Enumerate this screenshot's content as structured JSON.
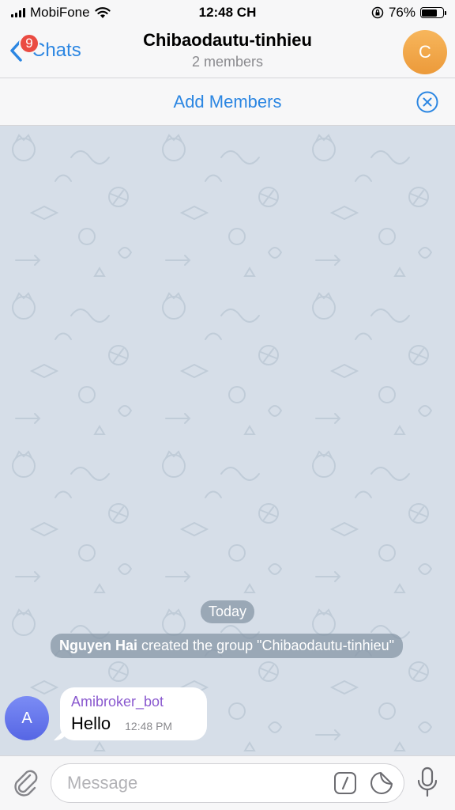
{
  "status_bar": {
    "carrier": "MobiFone",
    "time": "12:48 CH",
    "battery_percent": "76%",
    "battery_level": 0.76
  },
  "nav": {
    "back_label": "Chats",
    "badge_count": "9",
    "title": "Chibaodautu-tinhieu",
    "subtitle": "2 members",
    "avatar_letter": "C"
  },
  "banner": {
    "add_members_label": "Add Members"
  },
  "chat": {
    "date_label": "Today",
    "service_actor": "Nguyen Hai",
    "service_text": "created the group \"Chibaodautu-tinhieu\"",
    "messages": [
      {
        "avatar_letter": "A",
        "sender": "Amibroker_bot",
        "text": "Hello",
        "time": "12:48 PM"
      }
    ]
  },
  "input": {
    "placeholder": "Message"
  },
  "colors": {
    "accent": "#2b86e2",
    "badge": "#ea4b42",
    "sender_name": "#8a59cf",
    "chat_background": "#d6dee8"
  },
  "icons": [
    "signal-icon",
    "wifi-icon",
    "rotation-lock-icon",
    "battery-icon",
    "chevron-left-icon",
    "close-circle-icon",
    "paperclip-icon",
    "slash-command-icon",
    "sticker-icon",
    "microphone-icon"
  ]
}
